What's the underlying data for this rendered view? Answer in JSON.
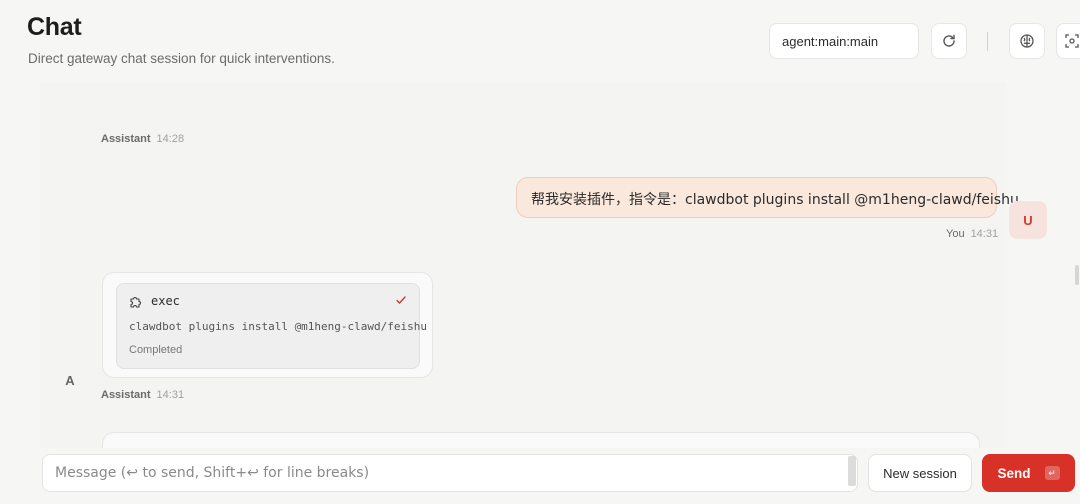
{
  "header": {
    "title": "Chat",
    "subtitle": "Direct gateway chat session for quick interventions.",
    "session_value": "agent:main:main",
    "refresh_icon": "refresh-icon",
    "brain_icon": "brain-icon",
    "focus_icon": "focus-icon"
  },
  "messages": [
    {
      "role": "Assistant",
      "time": "14:28"
    },
    {
      "role": "You",
      "time": "14:31",
      "avatar": "U",
      "text": "帮我安装插件，指令是：clawdbot plugins install @m1heng-clawd/feishu"
    },
    {
      "role": "Assistant",
      "time": "14:31",
      "avatar": "A",
      "tool": {
        "name": "exec",
        "command": "clawdbot plugins install @m1heng-clawd/feishu",
        "status": "Completed",
        "icon": "puzzle-icon",
        "status_icon": "check-icon"
      }
    }
  ],
  "composer": {
    "placeholder": "Message (↩ to send, Shift+↩ for line breaks)",
    "new_session_label": "New session",
    "send_label": "Send",
    "send_kbd": "↵"
  },
  "colors": {
    "accent": "#d83228",
    "user_bubble": "#fae8dd"
  }
}
